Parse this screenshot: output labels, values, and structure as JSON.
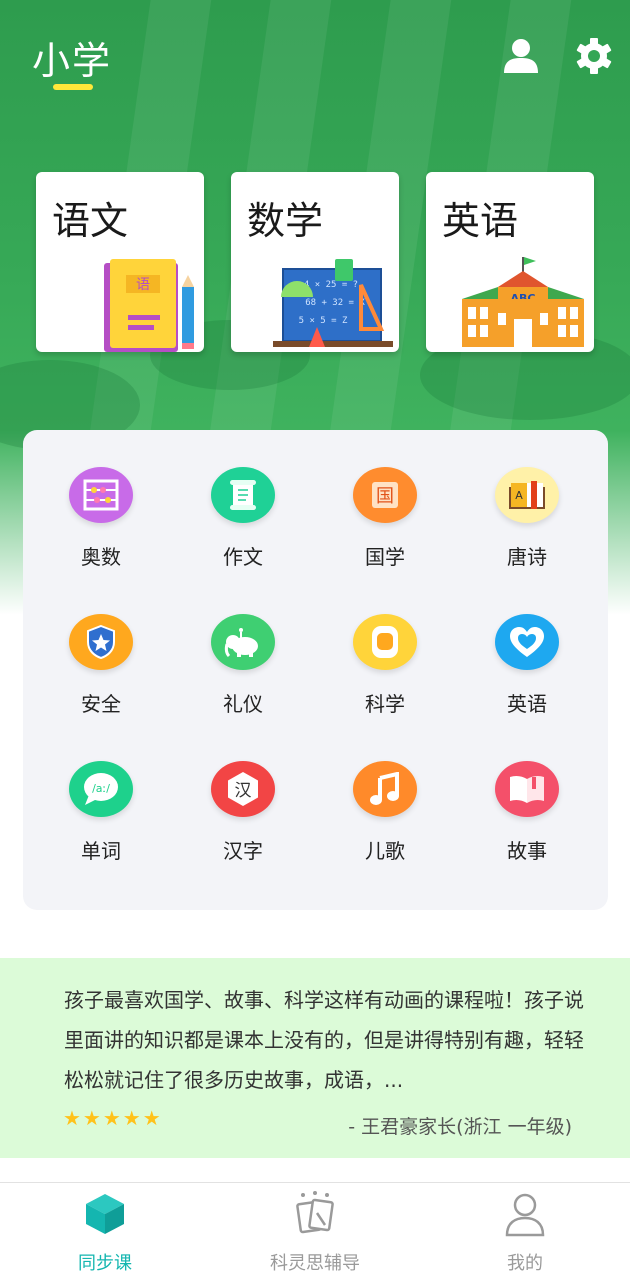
{
  "header": {
    "title": "小学",
    "accent_color": "#ffe83a",
    "icons": [
      "user-icon",
      "gear-icon"
    ]
  },
  "subject_cards": [
    {
      "label": "语文",
      "icon": "chinese-book-icon",
      "book_char": "语"
    },
    {
      "label": "数学",
      "icon": "math-board-icon",
      "board_lines": [
        "4 × 25 = ?",
        "68 + 32 = X",
        "5 × 5 = Z"
      ]
    },
    {
      "label": "英语",
      "icon": "school-building-icon",
      "sign": "ABC"
    }
  ],
  "categories": [
    {
      "label": "奥数",
      "icon": "abacus-icon",
      "color": "#c86be8"
    },
    {
      "label": "作文",
      "icon": "scroll-icon",
      "color": "#1fd196"
    },
    {
      "label": "国学",
      "icon": "guoxue-icon",
      "color": "#ff8c2e",
      "glyph": "国"
    },
    {
      "label": "唐诗",
      "icon": "poem-book-icon",
      "color": "#fff1a8"
    },
    {
      "label": "安全",
      "icon": "shield-star-icon",
      "color": "#ffa81e"
    },
    {
      "label": "礼仪",
      "icon": "elephant-icon",
      "color": "#3fcf72"
    },
    {
      "label": "科学",
      "icon": "device-icon",
      "color": "#ffd43a"
    },
    {
      "label": "英语",
      "icon": "heart-hands-icon",
      "color": "#1ea8f0"
    },
    {
      "label": "单词",
      "icon": "phonetic-bubble-icon",
      "color": "#1ed18c",
      "glyph": "/aː/"
    },
    {
      "label": "汉字",
      "icon": "hanzi-hexagon-icon",
      "color": "#f24545",
      "glyph": "汉"
    },
    {
      "label": "儿歌",
      "icon": "music-note-icon",
      "color": "#ff8a2a"
    },
    {
      "label": "故事",
      "icon": "open-book-icon",
      "color": "#f4506a"
    }
  ],
  "review": {
    "text": "孩子最喜欢国学、故事、科学这样有动画的课程啦！孩子说里面讲的知识都是课本上没有的，但是讲得特别有趣，轻轻松松就记住了很多历史故事，成语，...",
    "stars": "★★★★★",
    "rating": 5,
    "author": "- 王君豪家长(浙江 一年级)"
  },
  "tabbar": {
    "active_color": "#14b6b0",
    "tabs": [
      {
        "label": "同步课",
        "icon": "cube-icon",
        "active": true
      },
      {
        "label": "科灵思辅导",
        "icon": "tutoring-icon",
        "active": false
      },
      {
        "label": "我的",
        "icon": "profile-icon",
        "active": false
      }
    ]
  }
}
